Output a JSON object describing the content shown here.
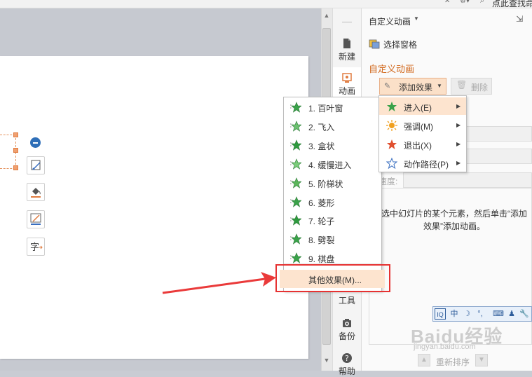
{
  "topbar": {
    "search_text": "点此查找命"
  },
  "side_tabs": [
    {
      "label": "新建",
      "icon": "new-file-icon"
    },
    {
      "label": "动画",
      "icon": "animation-icon"
    },
    {
      "label": "工具",
      "icon": "tools-icon"
    },
    {
      "label": "备份",
      "icon": "backup-icon"
    },
    {
      "label": "帮助",
      "icon": "help-icon"
    }
  ],
  "panel": {
    "title": "自定义动画",
    "select_pane": "选择窗格",
    "heading": "自定义动画",
    "add_effect": "添加效果",
    "delete": "删除",
    "speed_label": "速度:",
    "hint": "选中幻灯片的某个元素，然后单击“添加效果”添加动画。",
    "reorder": "重新排序"
  },
  "effects_menu": {
    "items": [
      "1. 百叶窗",
      "2. 飞入",
      "3. 盒状",
      "4. 缓慢进入",
      "5. 阶梯状",
      "6. 菱形",
      "7. 轮子",
      "8. 劈裂",
      "9. 棋盘"
    ],
    "other": "其他效果(M)..."
  },
  "category_menu": {
    "items": [
      {
        "label": "进入(E)",
        "icon": "enter-star-icon",
        "color": "#3aa24a"
      },
      {
        "label": "强调(M)",
        "icon": "emphasis-sun-icon",
        "color": "#f0a020"
      },
      {
        "label": "退出(X)",
        "icon": "exit-star-icon",
        "color": "#e05030"
      },
      {
        "label": "动作路径(P)",
        "icon": "motion-path-star-icon",
        "color": "#3a6fc0"
      }
    ]
  },
  "ime": {
    "label": "中"
  },
  "watermark": {
    "main": "Baidu经验",
    "sub": "jingyan.baidu.com"
  },
  "colors": {
    "accent": "#d2691e",
    "highlight": "#fde4cf",
    "annotation": "#e63232"
  }
}
